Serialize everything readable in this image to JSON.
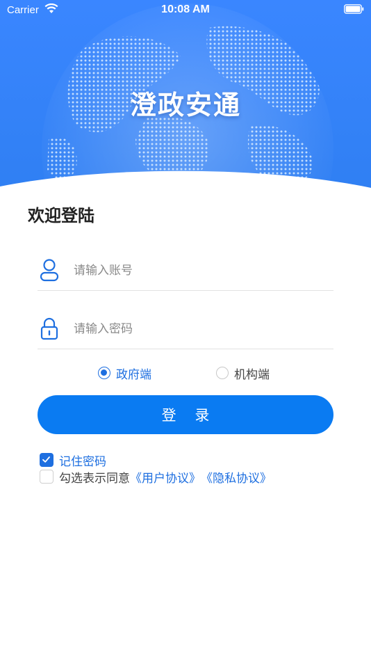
{
  "status_bar": {
    "carrier": "Carrier",
    "time": "10:08 AM"
  },
  "header": {
    "app_title": "澄政安通"
  },
  "login": {
    "welcome": "欢迎登陆",
    "account_placeholder": "请输入账号",
    "password_placeholder": "请输入密码",
    "role_options": [
      {
        "label": "政府端",
        "selected": true
      },
      {
        "label": "机构端",
        "selected": false
      }
    ],
    "login_button": "登 录",
    "remember_label": "记住密码",
    "remember_checked": true,
    "agree_prefix": "勾选表示同意",
    "user_agreement": "《用户协议》",
    "privacy_policy": "《隐私协议》",
    "agree_checked": false
  },
  "colors": {
    "header_blue": "#3a86ff",
    "accent": "#1e6fe0",
    "button": "#0a7bf2"
  }
}
